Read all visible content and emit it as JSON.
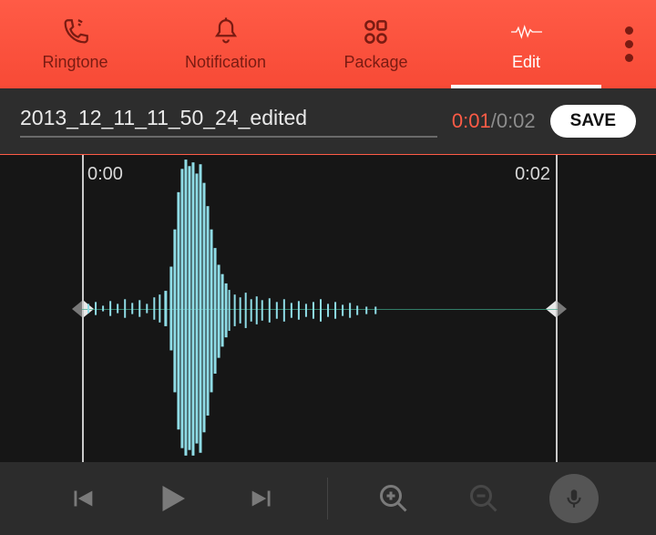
{
  "tabs": {
    "ringtone": "Ringtone",
    "notification": "Notification",
    "package": "Package",
    "edit": "Edit"
  },
  "file": {
    "name": "2013_12_11_11_50_24_edited",
    "current_time": "0:01",
    "separator": "/",
    "total_time": "0:02",
    "save_label": "SAVE"
  },
  "wave": {
    "start_label": "0:00",
    "end_label": "0:02"
  }
}
